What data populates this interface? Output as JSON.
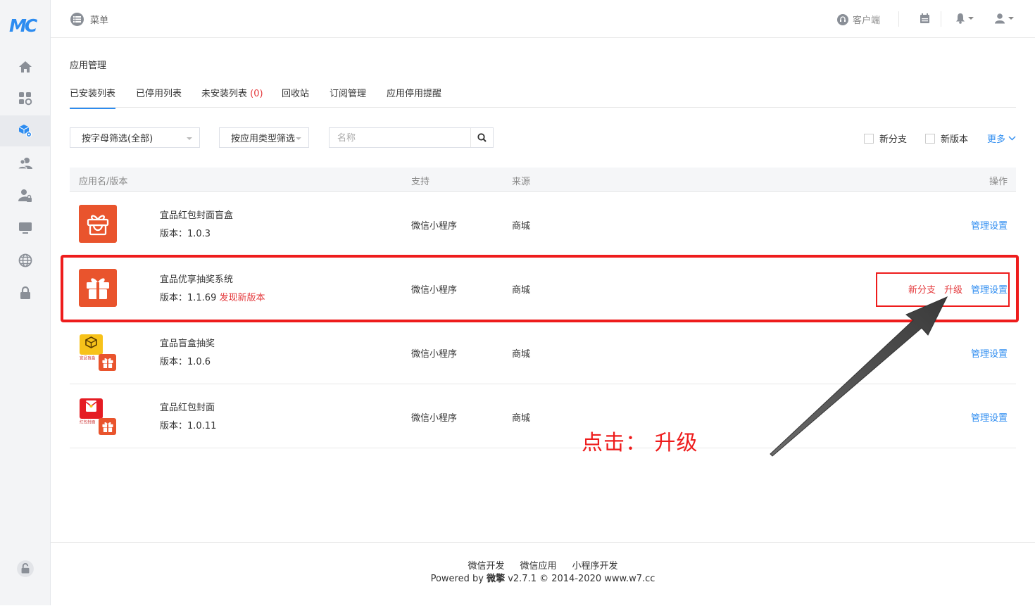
{
  "brand": {
    "logo_text": "MC"
  },
  "sidebar": {
    "items": [
      {
        "name": "home",
        "icon": "home-icon"
      },
      {
        "name": "apps",
        "icon": "grid-icon"
      },
      {
        "name": "app-management",
        "icon": "cube-settings-icon"
      },
      {
        "name": "users",
        "icon": "users-icon"
      },
      {
        "name": "user-permissions",
        "icon": "user-lock-icon"
      },
      {
        "name": "monitor",
        "icon": "monitor-icon"
      },
      {
        "name": "sites",
        "icon": "globe-icon"
      },
      {
        "name": "security",
        "icon": "lock-icon"
      }
    ],
    "bottom_icon": "unlock-icon"
  },
  "header": {
    "menu_label": "菜单",
    "client_label": "客户端",
    "icons": [
      "calendar-icon",
      "bell-icon",
      "user-icon"
    ]
  },
  "page": {
    "title": "应用管理",
    "tabs": [
      {
        "label": "已安装列表"
      },
      {
        "label": "已停用列表"
      },
      {
        "label": "未安装列表",
        "count": "(0)"
      },
      {
        "label": "回收站"
      },
      {
        "label": "订阅管理"
      },
      {
        "label": "应用停用提醒"
      }
    ]
  },
  "filters": {
    "letter_filter": "按字母筛选(全部)",
    "type_filter": "按应用类型筛选",
    "search_placeholder": "名称",
    "new_branch_label": "新分支",
    "new_version_label": "新版本",
    "more_label": "更多"
  },
  "table": {
    "headers": {
      "app": "应用名/版本",
      "support": "支持",
      "source": "来源",
      "action": "操作"
    },
    "rows": [
      {
        "name": "宜品红包封面盲盒",
        "version": "版本：1.0.3",
        "support": "微信小程序",
        "source": "商城",
        "manage": "管理设置"
      },
      {
        "name": "宜品优享抽奖系统",
        "version": "版本：1.1.69",
        "new_version": "发现新版本",
        "support": "微信小程序",
        "source": "商城",
        "new_branch": "新分支",
        "upgrade": "升级",
        "manage": "管理设置"
      },
      {
        "name": "宜品盲盒抽奖",
        "version": "版本：1.0.6",
        "support": "微信小程序",
        "source": "商城",
        "manage": "管理设置",
        "icon_caption": "宜品盲盒"
      },
      {
        "name": "宜品红包封面",
        "version": "版本：1.0.11",
        "support": "微信小程序",
        "source": "商城",
        "manage": "管理设置",
        "icon_caption": "红包封面"
      }
    ]
  },
  "annotation": {
    "callout": "点击： 升级",
    "color": "#ee1c1c"
  },
  "footer": {
    "links": [
      "微信开发",
      "微信应用",
      "小程序开发"
    ],
    "powered_prefix": "Powered by ",
    "powered_brand": "微擎",
    "powered_suffix": " v2.7.1 © 2014-2020 www.w7.cc"
  },
  "colors": {
    "accent": "#2d8cf0",
    "danger": "#e4393c",
    "app_icon": "#e9542d"
  }
}
